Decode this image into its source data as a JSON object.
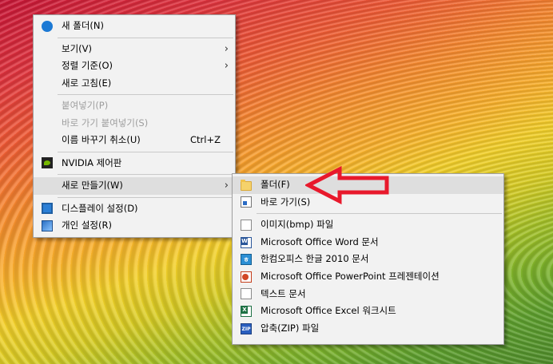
{
  "context_menu": {
    "items": [
      {
        "label": "새 폴더(N)",
        "icon": "new-folder-icon"
      },
      {
        "label": "보기(V)",
        "submenu": true
      },
      {
        "label": "정렬 기준(O)",
        "submenu": true
      },
      {
        "label": "새로 고침(E)"
      },
      {
        "label": "붙여넣기(P)",
        "disabled": true
      },
      {
        "label": "바로 가기 붙여넣기(S)",
        "disabled": true
      },
      {
        "label": "이름 바꾸기 취소(U)",
        "shortcut": "Ctrl+Z"
      },
      {
        "label": "NVIDIA 제어판",
        "icon": "nvidia-icon"
      },
      {
        "label": "새로 만들기(W)",
        "submenu": true,
        "highlighted": true
      },
      {
        "label": "디스플레이 설정(D)",
        "icon": "display-icon"
      },
      {
        "label": "개인 설정(R)",
        "icon": "personalize-icon"
      }
    ],
    "arrow_glyph": "›"
  },
  "new_submenu": {
    "items": [
      {
        "label": "폴더(F)",
        "icon": "folder-icon",
        "highlighted": true
      },
      {
        "label": "바로 가기(S)",
        "icon": "shortcut-icon"
      },
      {
        "label": "이미지(bmp) 파일",
        "icon": "bitmap-file-icon"
      },
      {
        "label": "Microsoft Office Word 문서",
        "icon": "word-document-icon",
        "icon_text": "W"
      },
      {
        "label": "한컴오피스 한글 2010 문서",
        "icon": "hwp-document-icon",
        "icon_text": "ㅎ"
      },
      {
        "label": "Microsoft Office PowerPoint 프레젠테이션",
        "icon": "powerpoint-icon"
      },
      {
        "label": "텍스트 문서",
        "icon": "text-document-icon"
      },
      {
        "label": "Microsoft Office Excel 워크시트",
        "icon": "excel-icon",
        "icon_text": "X"
      },
      {
        "label": "압축(ZIP) 파일",
        "icon": "zip-file-icon",
        "icon_text": "ZIP"
      }
    ]
  },
  "annotation": {
    "shape": "red-outline-arrow",
    "color": "#e8192c"
  },
  "colors": {
    "menu_bg": "#f2f2f2",
    "highlight": "#dedede",
    "disabled_text": "#9d9d9d"
  }
}
